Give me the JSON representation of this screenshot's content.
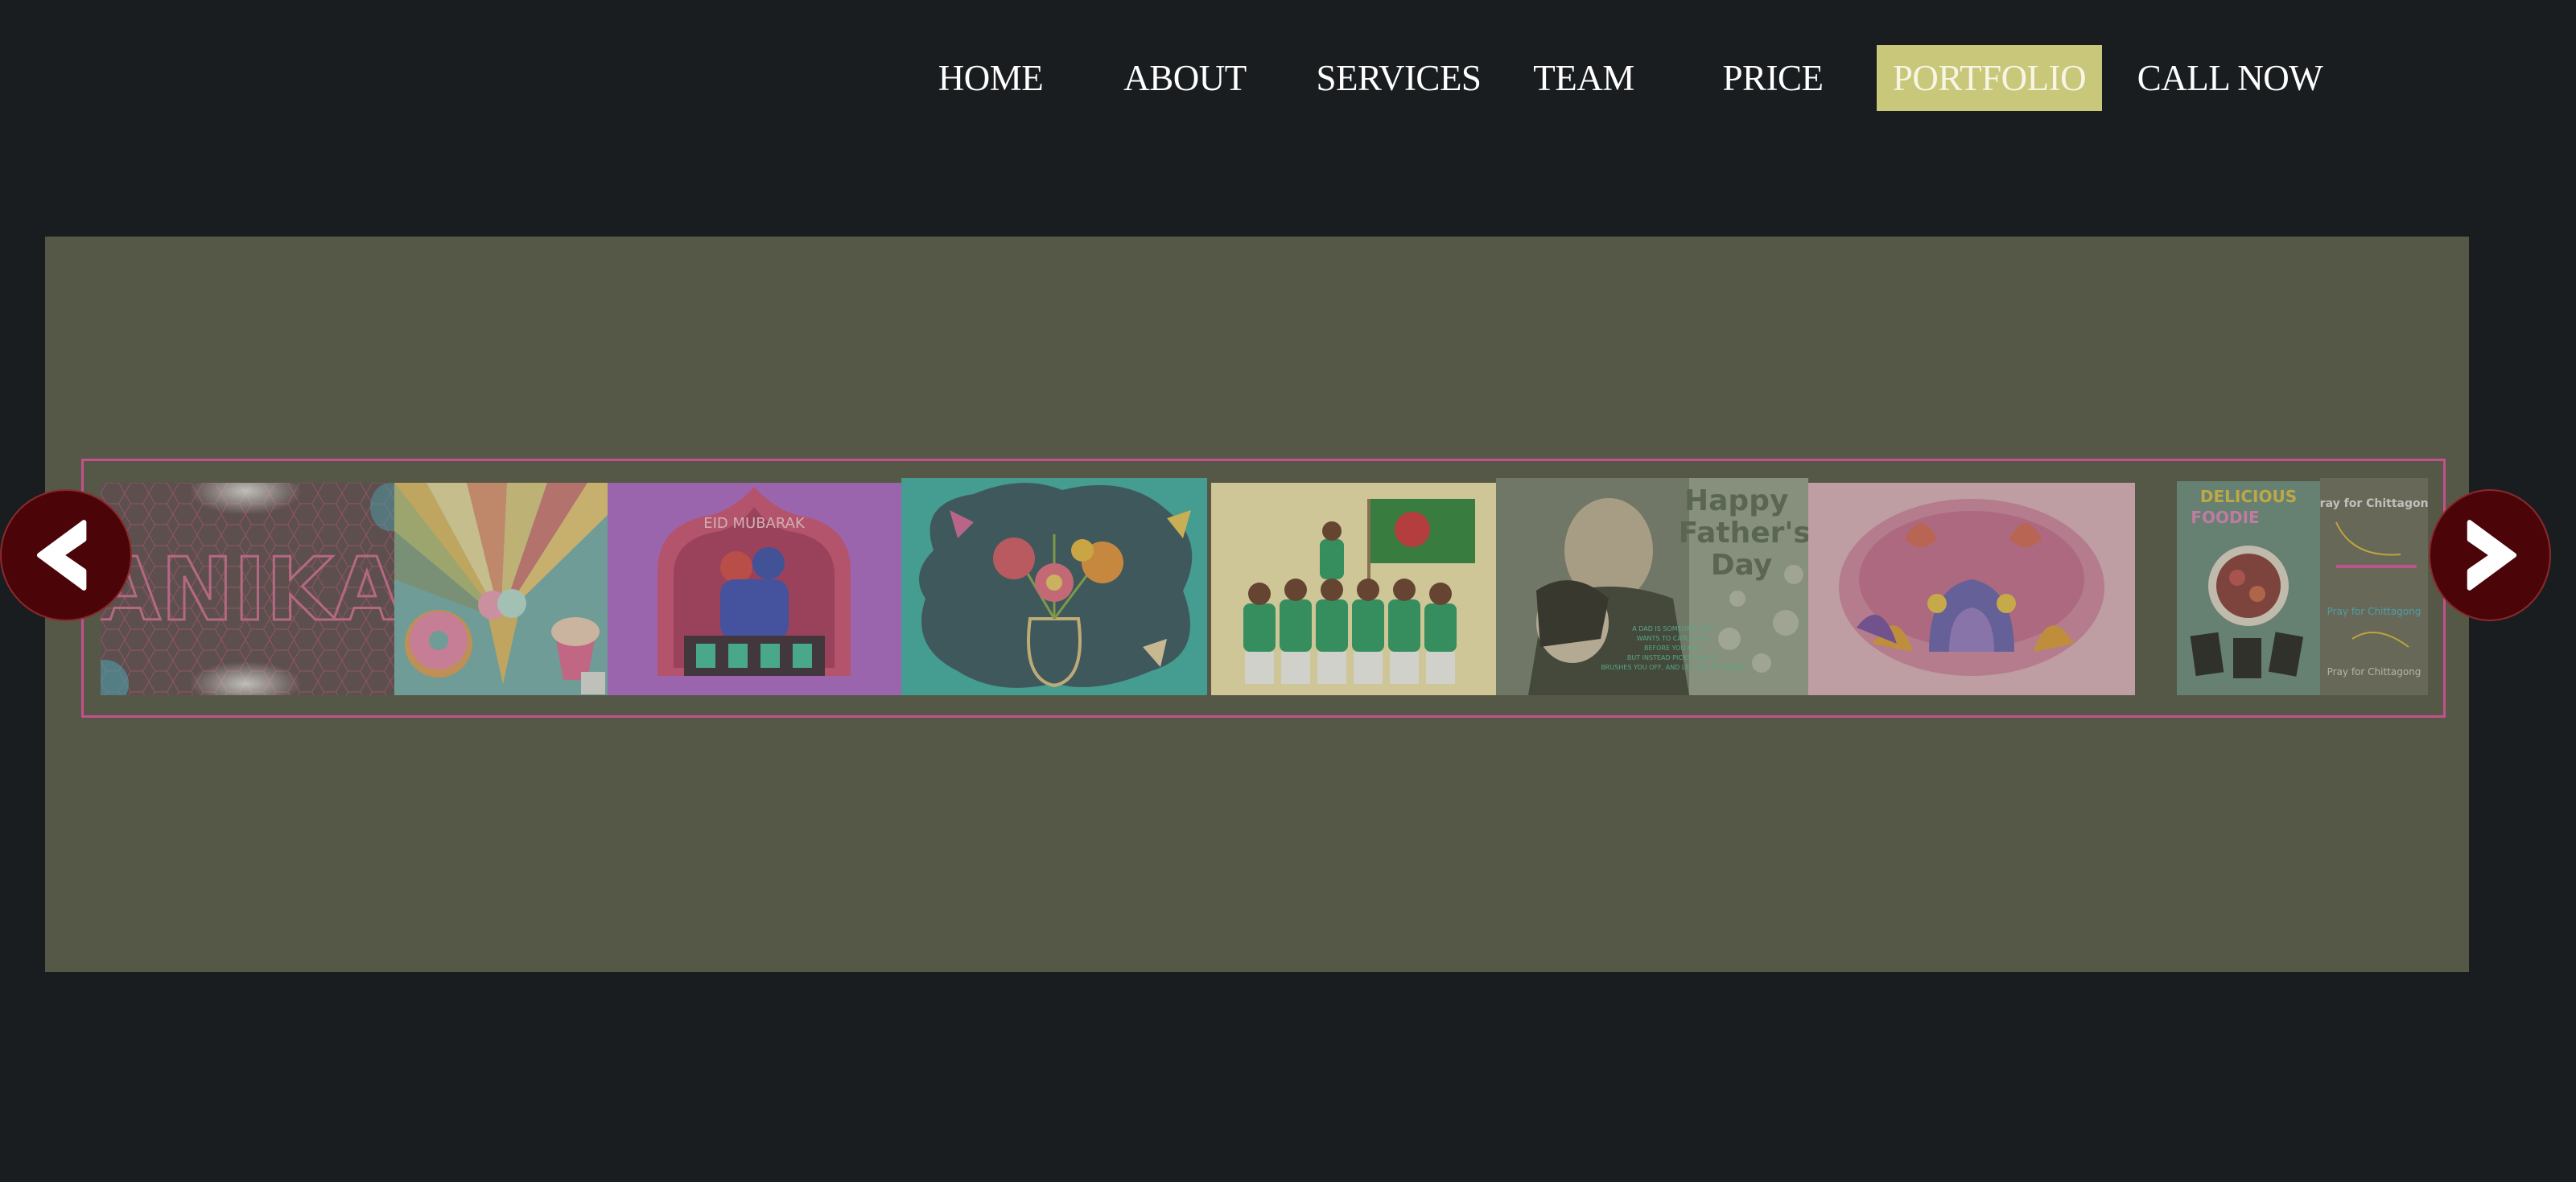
{
  "nav": {
    "items": [
      {
        "label": "HOME"
      },
      {
        "label": "ABOUT"
      },
      {
        "label": "SERVICES"
      },
      {
        "label": "TEAM"
      },
      {
        "label": "PRICE"
      },
      {
        "label": "PORTFOLIO",
        "active": true
      },
      {
        "label": "CALL NOW"
      }
    ],
    "active_color": "#c9c77a"
  },
  "gallery": {
    "prev_icon": "chevron-left-icon",
    "next_icon": "chevron-right-icon",
    "frame_color": "#c4508c",
    "panel_color": "#555846",
    "tiles": [
      {
        "name": "anika-typography",
        "text": "ANIKA"
      },
      {
        "name": "sweets-illustration"
      },
      {
        "name": "eid-mubarak-illustration",
        "text": "EID MUBARAK"
      },
      {
        "name": "flower-vase-illustration"
      },
      {
        "name": "cricket-team-flag-illustration"
      },
      {
        "name": "fathers-day-poster",
        "text": "Happy Father's Day"
      },
      {
        "name": "pink-house-illustration"
      },
      {
        "name": "delicious-foodie-poster",
        "text": "DELICIOUS FOODIE"
      },
      {
        "name": "pray-for-chittagong-poster",
        "text": "Pray for Chittagong"
      }
    ]
  }
}
